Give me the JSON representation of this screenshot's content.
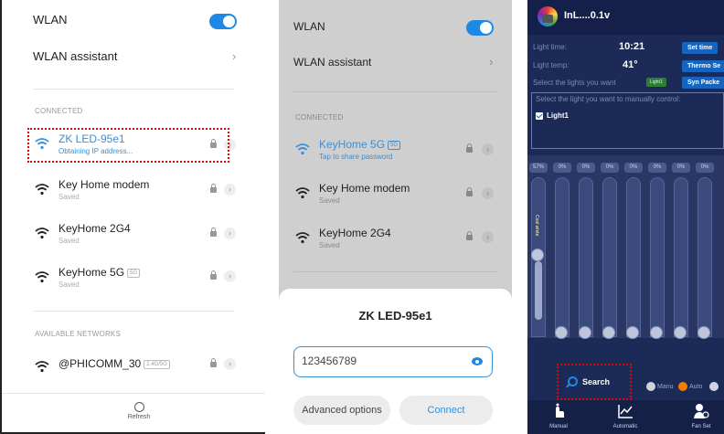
{
  "panel1": {
    "wlan_label": "WLAN",
    "assistant_label": "WLAN assistant",
    "connected_header": "CONNECTED",
    "networks": [
      {
        "name": "ZK LED-95e1",
        "sub": "Obtaining IP address..."
      },
      {
        "name": "Key Home modem",
        "sub": "Saved"
      },
      {
        "name": "KeyHome 2G4",
        "sub": "Saved"
      },
      {
        "name": "KeyHome 5G",
        "badge": "5G",
        "sub": "Saved"
      }
    ],
    "available_header": "AVAILABLE NETWORKS",
    "available": [
      {
        "name": "@PHICOMM_30",
        "badge": "2.4G/5G"
      }
    ],
    "refresh_label": "Refresh"
  },
  "panel2": {
    "wlan_label": "WLAN",
    "assistant_label": "WLAN assistant",
    "connected_header": "CONNECTED",
    "networks": [
      {
        "name": "KeyHome 5G",
        "badge": "5G",
        "sub": "Tap to share password"
      },
      {
        "name": "Key Home modem",
        "sub": "Saved"
      },
      {
        "name": "KeyHome 2G4",
        "sub": "Saved"
      }
    ],
    "dialog": {
      "title": "ZK LED-95e1",
      "password": "123456789",
      "advanced_label": "Advanced options",
      "connect_label": "Connect"
    }
  },
  "panel3": {
    "device_name": "InL....0.1v",
    "light_time_label": "Light time:",
    "light_time_value": "10:21",
    "set_time_label": "Set time",
    "light_temp_label": "Light temp:",
    "light_temp_value": "41°",
    "thermo_label": "Thermo Se",
    "select_lights_label": "Select the lights you want",
    "light_tag": "Light1",
    "syn_label": "Syn Packe",
    "manual_header": "Select the light you want to manually control:",
    "light_item": "Light1",
    "channels": [
      {
        "pct": "57%",
        "level": 0.57,
        "label": "Cool white"
      },
      {
        "pct": "0%",
        "level": 0,
        "label": ""
      },
      {
        "pct": "0%",
        "level": 0,
        "label": ""
      },
      {
        "pct": "0%",
        "level": 0,
        "label": ""
      },
      {
        "pct": "0%",
        "level": 0,
        "label": ""
      },
      {
        "pct": "0%",
        "level": 0,
        "label": ""
      },
      {
        "pct": "0%",
        "level": 0,
        "label": ""
      },
      {
        "pct": "0%",
        "level": 0,
        "label": ""
      }
    ],
    "search_label": "Search",
    "modes": [
      {
        "label": "Manu",
        "active": false
      },
      {
        "label": "Auto",
        "active": true
      },
      {
        "label": "",
        "active": false
      }
    ],
    "nav": [
      {
        "label": "Manual",
        "icon": "hand-icon"
      },
      {
        "label": "Automatic",
        "icon": "chart-icon"
      },
      {
        "label": "Fan Set",
        "icon": "fan-icon"
      }
    ],
    "colors": {
      "bg": "#1b2a57",
      "accent": "#1565c0",
      "auto_active": "#f57c00"
    }
  }
}
